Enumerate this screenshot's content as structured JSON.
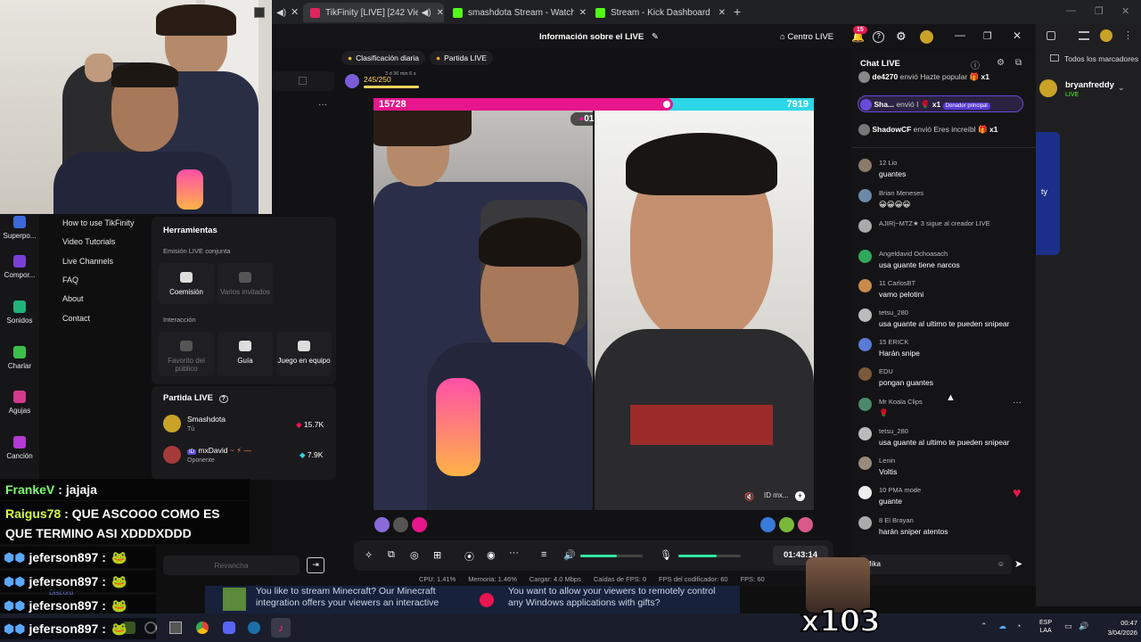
{
  "browser": {
    "tabs": [
      {
        "label": "TikFinity [LIVE] [242 Viewer",
        "color": "#e0245e"
      },
      {
        "label": "smashdota Stream - Watch Liv",
        "color": "#53fc18"
      },
      {
        "label": "Stream - Kick Dashboard",
        "color": "#53fc18"
      }
    ],
    "new_tab": "+",
    "bookmarks_label": "Todos los marcadores",
    "kick_user": "bryanfreddy",
    "kick_status": "LIVE",
    "kick_card_text": "ty"
  },
  "app": {
    "title": "Información sobre el LIVE",
    "centro_live": "Centro LIVE",
    "notif_count": "15",
    "goal_daily": "Clasificación diaria",
    "goal_partida": "Partida LIVE",
    "goal_progress": "245/250",
    "goal_time": "3 d 36 min 6 s"
  },
  "leftnav": {
    "items": [
      "Superpo...",
      "Compor...",
      "Sonidos",
      "Charlar",
      "Agujas",
      "Canción"
    ]
  },
  "help_menu": [
    "How to use TikFinity",
    "Video Tutorials",
    "Live Channels",
    "FAQ",
    "About",
    "Contact"
  ],
  "tools": {
    "title": "Herramientas",
    "section1": "Emisión LIVE conjunta",
    "btn_coemision": "Coemisión",
    "btn_varios": "Varios invitados",
    "section2": "Interacción",
    "btn_favorito": "Favorito del público",
    "btn_guia": "Guía",
    "btn_juego": "Juego en equipo"
  },
  "partida": {
    "title": "Partida LIVE",
    "players": [
      {
        "name": "Smashdota",
        "sub": "Tú",
        "score": "15.7K"
      },
      {
        "name": "mxDavid",
        "sub": "Oponente",
        "score": "7.9K"
      }
    ],
    "revancha": "Revancha"
  },
  "battle": {
    "score_left": "15728",
    "score_right": "7919",
    "timer": "01:07"
  },
  "controls": {
    "duration": "01:43:14"
  },
  "stats": [
    "CPU: 1.41%",
    "Memoria: 1.46%",
    "Cargar: 4.0 Mbps",
    "Caídas de FPS: 0",
    "FPS del codificador: 60",
    "FPS: 60"
  ],
  "chat": {
    "title": "Chat LIVE",
    "gifts": [
      {
        "user": "de4270",
        "text": "envió Hazte popular",
        "count": "x1"
      },
      {
        "user": "Sha...",
        "text": "envió I",
        "count": "x1",
        "badge": "Donador principal"
      },
      {
        "user": "ShadowCF",
        "text": "envió Eres increíbl",
        "count": "x1"
      }
    ],
    "messages": [
      {
        "user": "12  Lio",
        "text": "guantes"
      },
      {
        "user": "Brian Meneses",
        "text": "😀😀😀😀"
      },
      {
        "user": "AJIR|~MTZ★  3  sigue al creador LIVE",
        "text": ""
      },
      {
        "user": "Angeldavid Ochoasach",
        "text": "usa guante tiene narcos"
      },
      {
        "user": "11  CarlosBT",
        "text": "vamo pelotini"
      },
      {
        "user": "tetsu_280",
        "text": "usa guante al ultimo te pueden snipear"
      },
      {
        "user": "15  ERICK",
        "text": "Harán snipe"
      },
      {
        "user": "EDU",
        "text": "pongan guantes"
      },
      {
        "user": "Mr Koala Clips",
        "text": "🌹"
      },
      {
        "user": "tetsu_280",
        "text": "usa guante al ultimo te pueden snipear"
      },
      {
        "user": "Lenin",
        "text": "Voltis"
      },
      {
        "user": "10  PMA mode",
        "text": "guante"
      },
      {
        "user": "8  El Brayan",
        "text": "harán sniper atentos"
      }
    ],
    "input_user": "Mika"
  },
  "overlays": [
    {
      "user": "FrankeV",
      "text": "jajaja"
    },
    {
      "user": "Raigus78",
      "text": "QUE ASCOOO COMO ES QUE TERMINO ASI XDDDXDDD"
    },
    {
      "user": "jeferson897",
      "text": ""
    },
    {
      "user": "jeferson897",
      "text": ""
    },
    {
      "user": "jeferson897",
      "text": ""
    },
    {
      "user": "jeferson897",
      "text": ""
    }
  ],
  "ads": {
    "left": "You like to stream Minecraft? Our Minecraft integration offers your viewers an interactive",
    "right": "You want to allow your viewers to remotely control any Windows applications with gifts?"
  },
  "discord_label": "Discord",
  "combo": "x103",
  "taskbar": {
    "lang": "ESP",
    "lang2": "LAA",
    "time": "00:47",
    "date": "3/04/2026"
  }
}
